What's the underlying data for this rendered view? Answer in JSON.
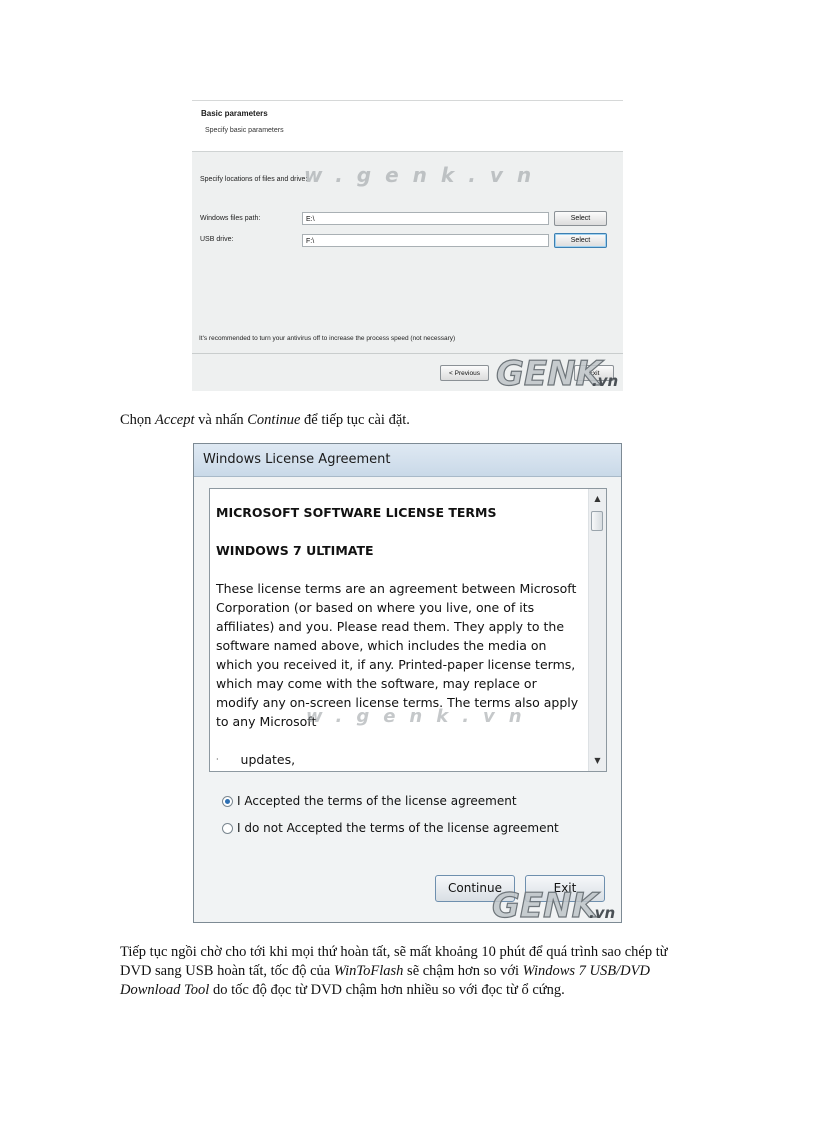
{
  "screenshot1": {
    "header_title": "Basic parameters",
    "header_subtitle": "Specify basic parameters",
    "locations_label": "Specify locations of files and drive:",
    "windows_path_label": "Windows files path:",
    "windows_path_value": "E:\\",
    "usb_drive_label": "USB drive:",
    "usb_drive_value": "F:\\",
    "select_label_1": "Select",
    "select_label_2": "Select",
    "note": "It's recommended to turn your antivirus off to increase the process speed (not necessary)",
    "previous_label": "< Previous",
    "exit_label": "Exit",
    "watermark_url": "w.genk.vn",
    "watermark_logo": "GENK",
    "watermark_logo_suffix": ".vn"
  },
  "paragraph1": {
    "t1": "Chọn ",
    "accept": "Accept",
    "t2": " và nhấn ",
    "continue": "Continue",
    "t3": " để tiếp tục cài đặt."
  },
  "screenshot2": {
    "window_title": "Windows License Agreement",
    "heading1": "MICROSOFT SOFTWARE LICENSE TERMS",
    "heading2": "WINDOWS 7 ULTIMATE",
    "body_lines": [
      "These license terms are an agreement between Microsoft",
      "Corporation (or based on where you live, one of its",
      "affiliates) and you. Please read them. They apply to the",
      "software named above, which includes the media on",
      "which you received it, if any. Printed-paper license terms,",
      "which may come with the software, may replace or",
      "modify any on-screen license terms. The terms also apply",
      "to any Microsoft"
    ],
    "bullet_item": "updates,",
    "radio_accept": "I Accepted the terms of the license agreement",
    "radio_decline": "I do not Accepted the terms of the license agreement",
    "continue_label": "Continue",
    "exit_label": "Exit",
    "watermark_url": "w.genk.vn",
    "watermark_logo": "GENK",
    "watermark_logo_suffix": ".vn"
  },
  "paragraph2": {
    "t1": "Tiếp tục ngồi chờ cho tới khi mọi thứ hoàn tất, sẽ mất khoảng 10 phút để quá trình sao chép từ DVD sang USB hoàn tất, tốc độ của ",
    "wintoflash": "WinToFlash",
    "t2": " sẽ chậm hơn so với ",
    "tool": "Windows 7 USB/DVD Download Tool",
    "t3": " do tốc độ đọc từ DVD chậm hơn nhiều so với đọc từ ổ cứng."
  }
}
